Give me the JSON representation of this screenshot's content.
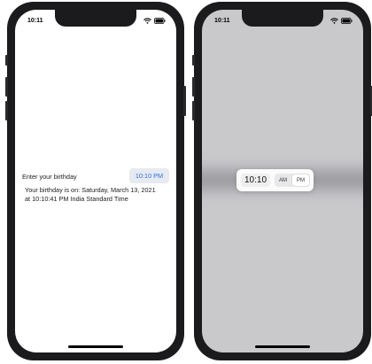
{
  "left_screen": {
    "status_time": "10:11",
    "prompt_label": "Enter your birthday",
    "time_value": "10:10 PM",
    "result_line1": "Your birthday is on: Saturday, March 13, 2021",
    "result_line2": "at 10:10:41 PM India Standard Time"
  },
  "right_screen": {
    "status_time": "10:11",
    "picker": {
      "time": "10:10",
      "am_label": "AM",
      "pm_label": "PM",
      "selected_period": "PM"
    }
  },
  "colors": {
    "accent": "#2f6fe0",
    "pill_background": "#e7eaf0",
    "dimmed_background": "#c9c9cc",
    "device_bezel": "#1b1b1d"
  },
  "icons": [
    "wifi-icon",
    "battery-icon"
  ]
}
